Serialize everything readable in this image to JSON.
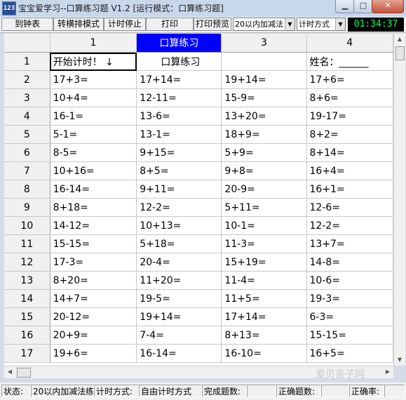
{
  "window": {
    "icon_text": "123",
    "title": "宝宝爱学习--口算练习题 V1.2  [运行模式：口算练习题]"
  },
  "controls": {
    "minimize": "▁",
    "maximize": "□",
    "close": "✕"
  },
  "toolbar": {
    "btn_clock_table": "到钟表",
    "btn_layout": "转横排模式",
    "btn_timer_stop": "计时停止",
    "btn_print": "打印",
    "btn_print_preview": "打印预览",
    "range_select": "20以内加减法",
    "timing_select": "计时方式",
    "clock": "01:34:37"
  },
  "grid": {
    "columns": [
      "1",
      "口算练习",
      "3",
      "4"
    ],
    "row1": {
      "num": "1",
      "c1": "开始计时！ ↓",
      "c2": "口算练习",
      "c3": "",
      "c4": "姓名：______"
    },
    "rows": [
      {
        "num": "2",
        "cells": [
          "17+3=",
          "17+14=",
          "19+14=",
          "17+6="
        ]
      },
      {
        "num": "3",
        "cells": [
          "10+4=",
          "12-11=",
          "15-9=",
          "8+6="
        ]
      },
      {
        "num": "4",
        "cells": [
          "16-1=",
          "13-6=",
          "13+20=",
          "19-17="
        ]
      },
      {
        "num": "5",
        "cells": [
          "5-1=",
          "13-1=",
          "18+9=",
          "8+2="
        ]
      },
      {
        "num": "6",
        "cells": [
          "8-5=",
          "9+15=",
          "5+9=",
          "8+14="
        ]
      },
      {
        "num": "7",
        "cells": [
          "10+16=",
          "8+5=",
          "9+8=",
          "16+4="
        ]
      },
      {
        "num": "8",
        "cells": [
          "16-14=",
          "9+11=",
          "20-9=",
          "16+1="
        ]
      },
      {
        "num": "9",
        "cells": [
          "8+18=",
          "12-2=",
          "5+11=",
          "12-6="
        ]
      },
      {
        "num": "10",
        "cells": [
          "14-12=",
          "10+13=",
          "10-1=",
          "12-2="
        ]
      },
      {
        "num": "11",
        "cells": [
          "15-15=",
          "5+18=",
          "11-3=",
          "13+7="
        ]
      },
      {
        "num": "12",
        "cells": [
          "17-3=",
          "20-4=",
          "15+19=",
          "14-8="
        ]
      },
      {
        "num": "13",
        "cells": [
          "8+20=",
          "11+20=",
          "11-4=",
          "10-6="
        ]
      },
      {
        "num": "14",
        "cells": [
          "14+7=",
          "19-5=",
          "11+5=",
          "19-3="
        ]
      },
      {
        "num": "15",
        "cells": [
          "20-12=",
          "19+14=",
          "17+14=",
          "6-3="
        ]
      },
      {
        "num": "16",
        "cells": [
          "20+9=",
          "7-4=",
          "8+13=",
          "15-15="
        ]
      },
      {
        "num": "17",
        "cells": [
          "19+6=",
          "16-14=",
          "16-10=",
          "16+5="
        ]
      }
    ]
  },
  "statusbar": {
    "state_label": "状态:",
    "state_value": "20以内加减法练",
    "timing_label": "计时方式:",
    "timing_value": "自由计时方式",
    "done_label": "完成题数:",
    "done_value": "",
    "correct_label": "正确题数:",
    "correct_value": "",
    "rate_label": "正确率:",
    "rate_value": ""
  },
  "watermark": "爱贝亲子网"
}
